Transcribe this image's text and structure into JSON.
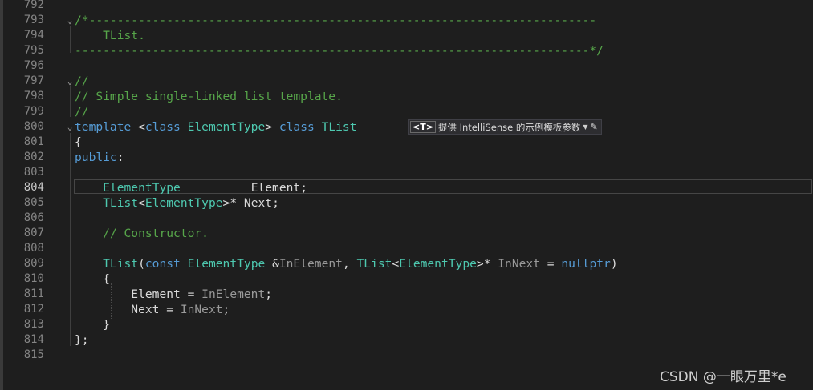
{
  "editor": {
    "lines": [
      {
        "num": "792",
        "fold": "",
        "tokens": []
      },
      {
        "num": "793",
        "fold": "⌄",
        "tokens": [
          {
            "t": "/*------------------------------------------------------------------------",
            "c": "cmt"
          }
        ]
      },
      {
        "num": "794",
        "fold": "",
        "tokens": [
          {
            "t": "    TList.",
            "c": "cmt"
          }
        ]
      },
      {
        "num": "795",
        "fold": "",
        "tokens": [
          {
            "t": "-------------------------------------------------------------------------*/",
            "c": "cmt"
          }
        ]
      },
      {
        "num": "796",
        "fold": "",
        "tokens": []
      },
      {
        "num": "797",
        "fold": "⌄",
        "tokens": [
          {
            "t": "//",
            "c": "cmt"
          }
        ]
      },
      {
        "num": "798",
        "fold": "",
        "tokens": [
          {
            "t": "// Simple single-linked list template.",
            "c": "cmt"
          }
        ]
      },
      {
        "num": "799",
        "fold": "",
        "tokens": [
          {
            "t": "//",
            "c": "cmt"
          }
        ]
      },
      {
        "num": "800",
        "fold": "⌄",
        "tokens": [
          {
            "t": "template",
            "c": "kw"
          },
          {
            "t": " <",
            "c": "pl"
          },
          {
            "t": "class",
            "c": "kw"
          },
          {
            "t": " ",
            "c": "pl"
          },
          {
            "t": "ElementType",
            "c": "ty"
          },
          {
            "t": "> ",
            "c": "pl"
          },
          {
            "t": "class",
            "c": "kw"
          },
          {
            "t": " ",
            "c": "pl"
          },
          {
            "t": "TList",
            "c": "ty"
          }
        ]
      },
      {
        "num": "801",
        "fold": "",
        "tokens": [
          {
            "t": "{",
            "c": "pl"
          }
        ]
      },
      {
        "num": "802",
        "fold": "",
        "tokens": [
          {
            "t": "public",
            "c": "kw"
          },
          {
            "t": ":",
            "c": "pl"
          }
        ]
      },
      {
        "num": "803",
        "fold": "",
        "tokens": []
      },
      {
        "num": "804",
        "fold": "",
        "tokens": [
          {
            "t": "    ",
            "c": "pl"
          },
          {
            "t": "ElementType",
            "c": "ty"
          },
          {
            "t": "          ",
            "c": "pl"
          },
          {
            "t": "Element",
            "c": "var"
          },
          {
            "t": ";",
            "c": "pl"
          }
        ]
      },
      {
        "num": "805",
        "fold": "",
        "tokens": [
          {
            "t": "    ",
            "c": "pl"
          },
          {
            "t": "TList",
            "c": "ty"
          },
          {
            "t": "<",
            "c": "pl"
          },
          {
            "t": "ElementType",
            "c": "ty"
          },
          {
            "t": ">* ",
            "c": "pl"
          },
          {
            "t": "Next",
            "c": "var"
          },
          {
            "t": ";",
            "c": "pl"
          }
        ]
      },
      {
        "num": "806",
        "fold": "",
        "tokens": []
      },
      {
        "num": "807",
        "fold": "",
        "tokens": [
          {
            "t": "    ",
            "c": "pl"
          },
          {
            "t": "// Constructor.",
            "c": "cmt"
          }
        ]
      },
      {
        "num": "808",
        "fold": "",
        "tokens": []
      },
      {
        "num": "809",
        "fold": "",
        "tokens": [
          {
            "t": "    ",
            "c": "pl"
          },
          {
            "t": "TList",
            "c": "ty"
          },
          {
            "t": "(",
            "c": "pl"
          },
          {
            "t": "const",
            "c": "kw"
          },
          {
            "t": " ",
            "c": "pl"
          },
          {
            "t": "ElementType",
            "c": "ty"
          },
          {
            "t": " &",
            "c": "pl"
          },
          {
            "t": "InElement",
            "c": "prm"
          },
          {
            "t": ", ",
            "c": "pl"
          },
          {
            "t": "TList",
            "c": "ty"
          },
          {
            "t": "<",
            "c": "pl"
          },
          {
            "t": "ElementType",
            "c": "ty"
          },
          {
            "t": ">* ",
            "c": "pl"
          },
          {
            "t": "InNext",
            "c": "prm"
          },
          {
            "t": " = ",
            "c": "pl"
          },
          {
            "t": "nullptr",
            "c": "kw"
          },
          {
            "t": ")",
            "c": "pl"
          }
        ]
      },
      {
        "num": "810",
        "fold": "",
        "tokens": [
          {
            "t": "    {",
            "c": "pl"
          }
        ]
      },
      {
        "num": "811",
        "fold": "",
        "tokens": [
          {
            "t": "        ",
            "c": "pl"
          },
          {
            "t": "Element",
            "c": "var"
          },
          {
            "t": " = ",
            "c": "pl"
          },
          {
            "t": "InElement",
            "c": "prm"
          },
          {
            "t": ";",
            "c": "pl"
          }
        ]
      },
      {
        "num": "812",
        "fold": "",
        "tokens": [
          {
            "t": "        ",
            "c": "pl"
          },
          {
            "t": "Next",
            "c": "var"
          },
          {
            "t": " = ",
            "c": "pl"
          },
          {
            "t": "InNext",
            "c": "prm"
          },
          {
            "t": ";",
            "c": "pl"
          }
        ]
      },
      {
        "num": "813",
        "fold": "",
        "tokens": [
          {
            "t": "    }",
            "c": "pl"
          }
        ]
      },
      {
        "num": "814",
        "fold": "",
        "tokens": [
          {
            "t": "};",
            "c": "pl"
          }
        ]
      },
      {
        "num": "815",
        "fold": "",
        "tokens": []
      }
    ],
    "active_line": "804"
  },
  "intellisense_hint": {
    "badge": "<T>",
    "label": "提供 IntelliSense 的示例模板参数",
    "dropdown_icon": "chevron-down-icon",
    "edit_icon": "pencil-icon"
  },
  "watermark": "CSDN @一眼万里*e",
  "colors": {
    "background": "#1e1e1e",
    "comment": "#57a64a",
    "keyword": "#569cd6",
    "type": "#4ec9b0",
    "line_number": "#858585"
  }
}
